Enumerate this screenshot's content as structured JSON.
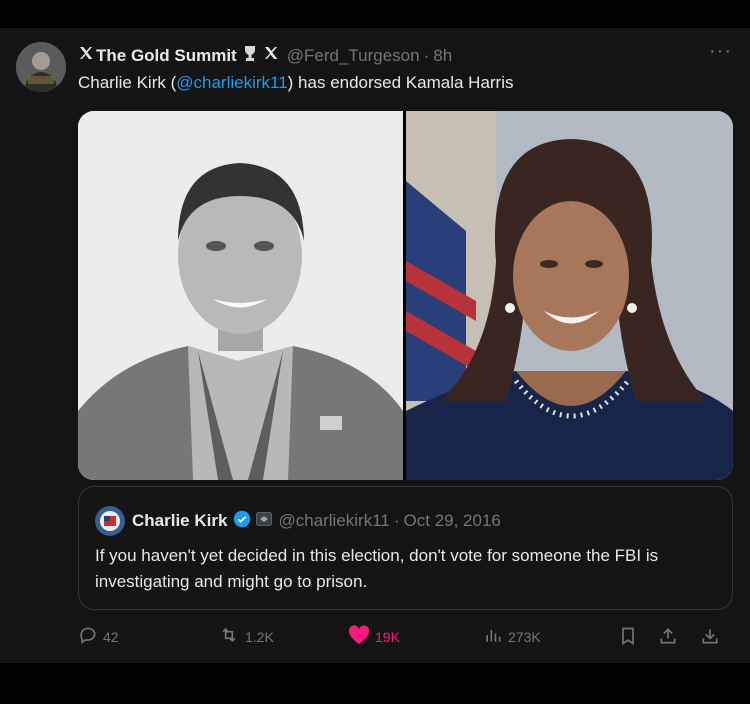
{
  "tweet": {
    "display_name": "The Gold Summit",
    "handle": "@Ferd_Turgeson",
    "separator": "·",
    "time": "8h",
    "text_before": "Charlie Kirk (",
    "mention": "@charliekirk11",
    "text_after": ") has endorsed Kamala Harris",
    "more_label": "···"
  },
  "quote": {
    "display_name": "Charlie Kirk",
    "handle": "@charliekirk11",
    "separator": "·",
    "date": "Oct 29, 2016",
    "text": "If you haven't yet decided in this election, don't vote for someone the FBI is investigating and might go to prison."
  },
  "actions": {
    "replies": "42",
    "reposts": "1.2K",
    "likes": "19K",
    "views": "273K"
  },
  "colors": {
    "background": "#141414",
    "accent": "#1d9bf0",
    "like": "#f91880",
    "muted": "#71767b",
    "text": "#e7e9ea"
  },
  "icons": [
    "x-logo-icon",
    "trophy-icon",
    "more-icon",
    "verified-badge-icon",
    "affiliate-badge-icon",
    "reply-icon",
    "repost-icon",
    "heart-icon",
    "views-icon",
    "bookmark-icon",
    "share-icon",
    "download-icon"
  ]
}
